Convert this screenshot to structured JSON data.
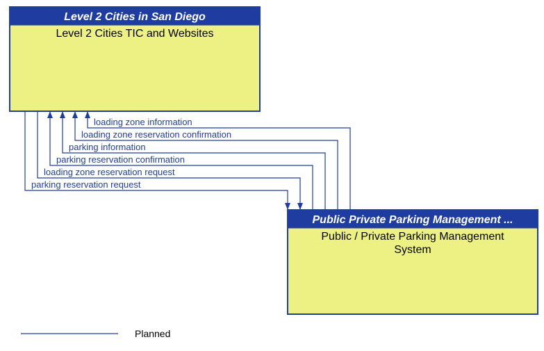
{
  "box_left": {
    "header": "Level 2 Cities in San Diego",
    "body_line1": "Level 2 Cities TIC and Websites"
  },
  "box_right": {
    "header": "Public Private Parking Management ...",
    "body_line1": "Public / Private Parking Management",
    "body_line2": "System"
  },
  "flows": [
    {
      "label": "loading zone information",
      "direction": "to_left"
    },
    {
      "label": "loading zone reservation confirmation",
      "direction": "to_left"
    },
    {
      "label": "parking information",
      "direction": "to_left"
    },
    {
      "label": "parking reservation confirmation",
      "direction": "to_left"
    },
    {
      "label": "loading zone reservation request",
      "direction": "to_right"
    },
    {
      "label": "parking reservation request",
      "direction": "to_right"
    }
  ],
  "legend": {
    "label": "Planned"
  }
}
